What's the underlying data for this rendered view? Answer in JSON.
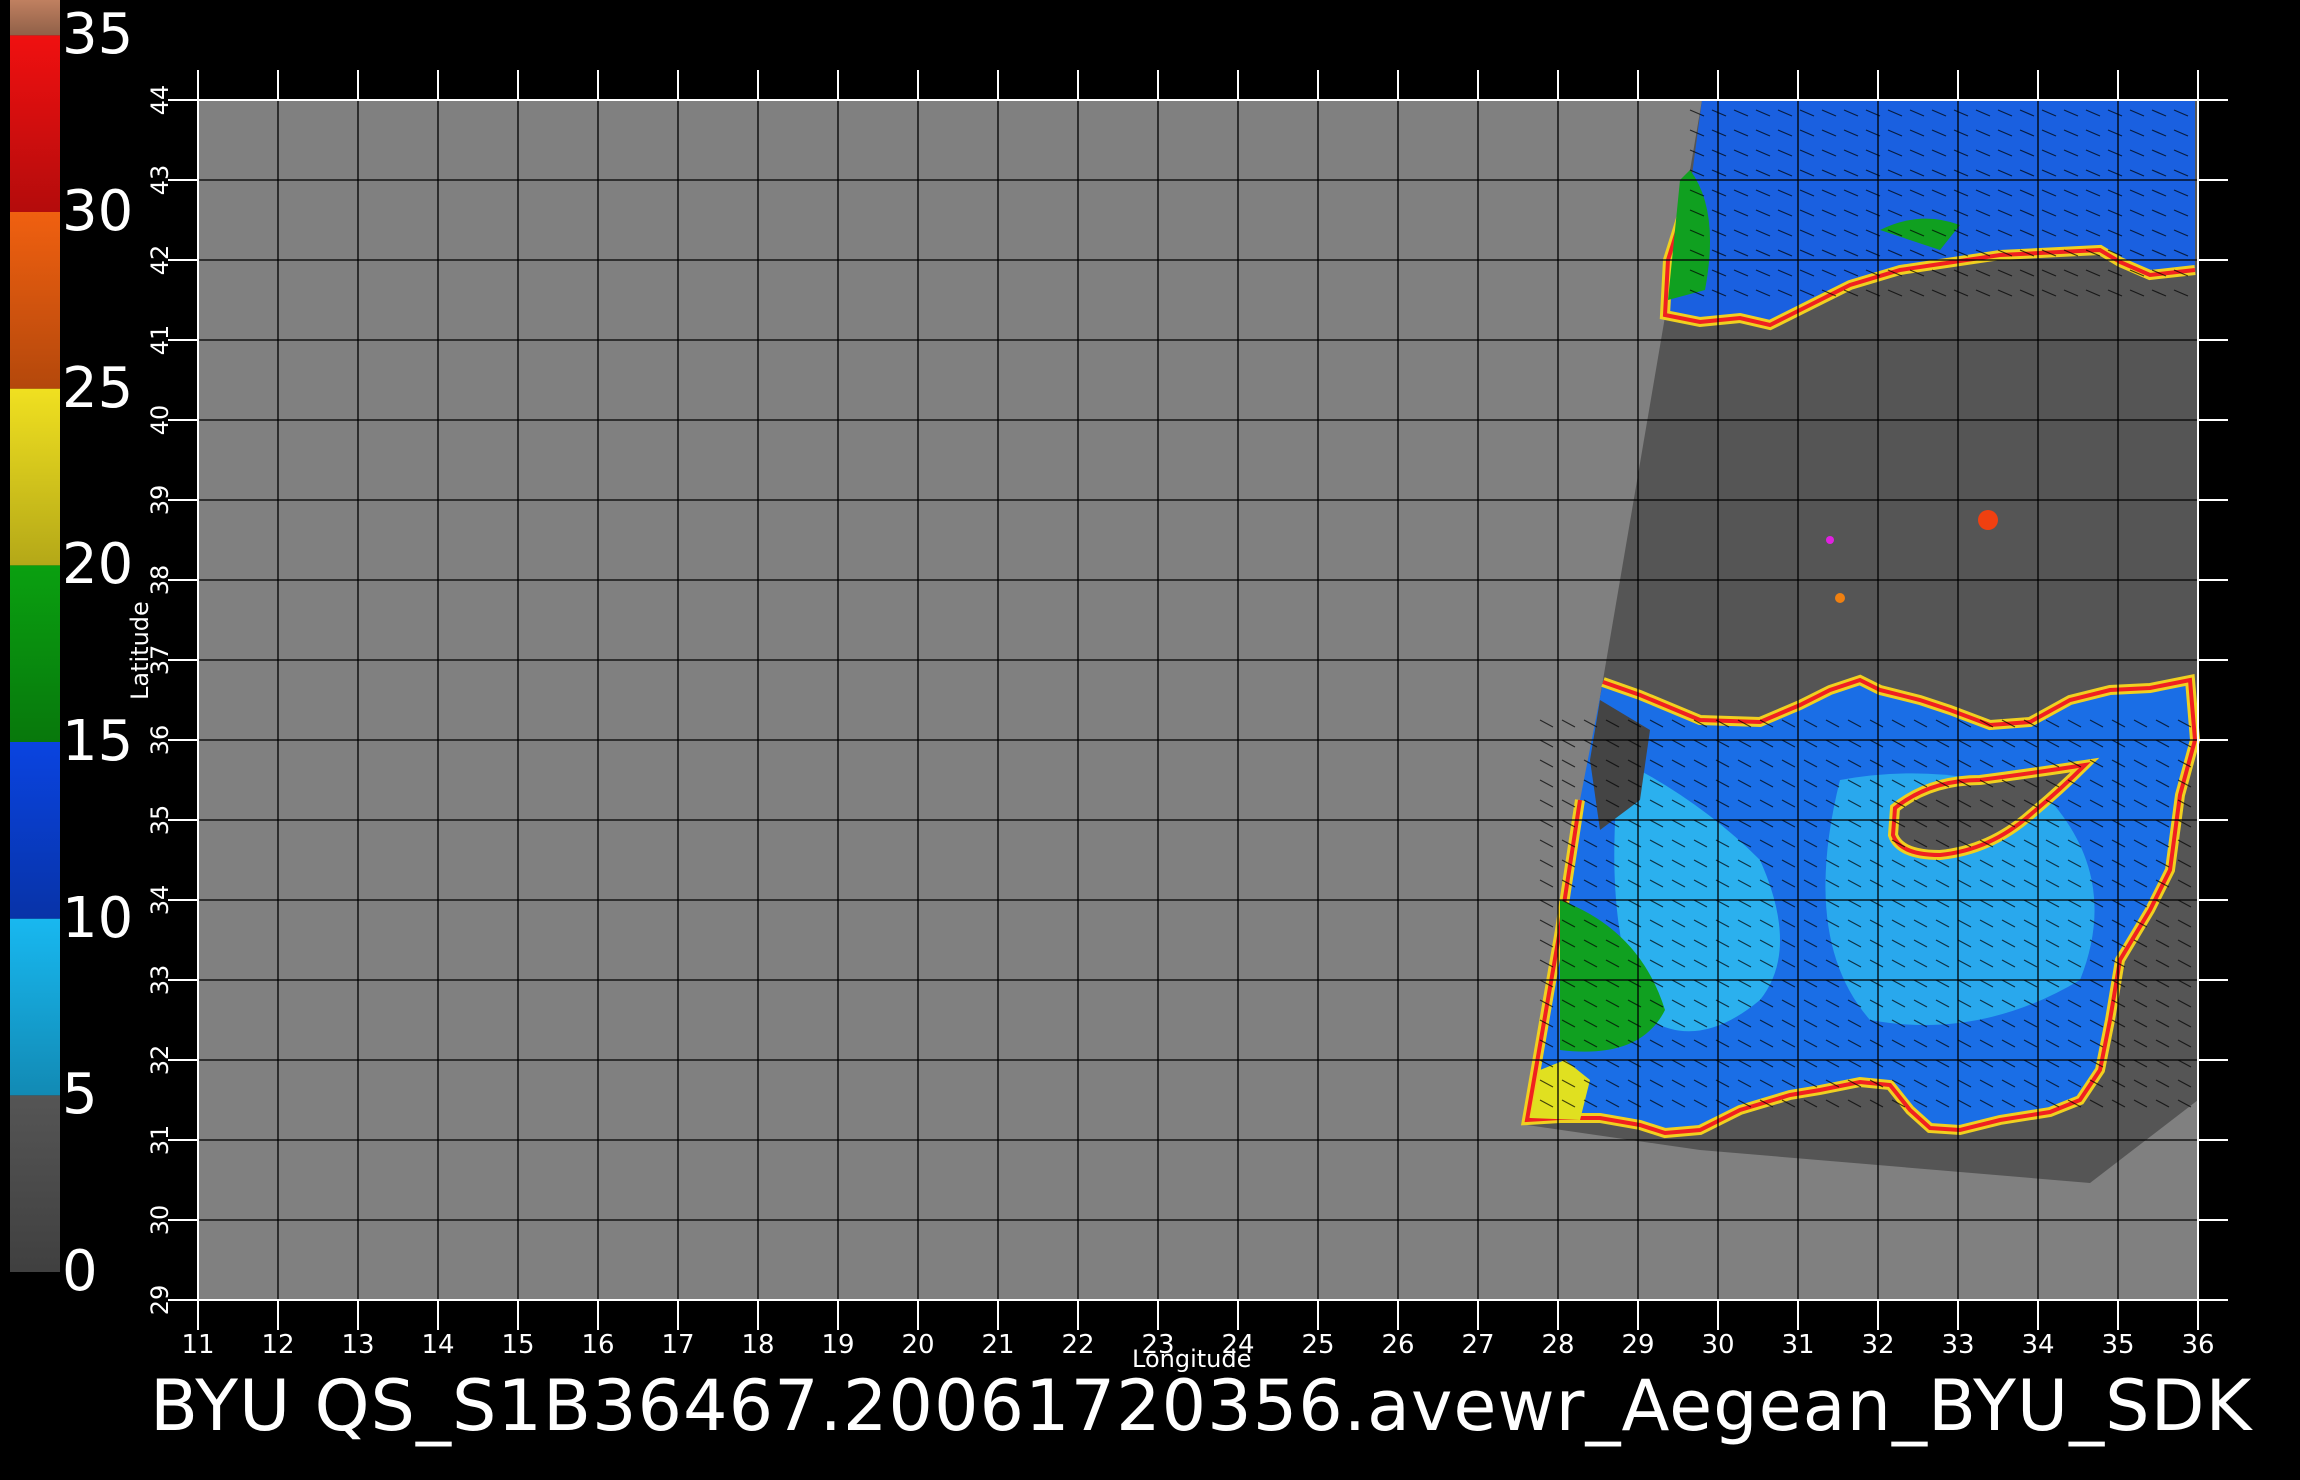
{
  "colorbar": {
    "labels": [
      "35",
      "30",
      "25",
      "20",
      "15",
      "10",
      "5",
      "0"
    ],
    "segments": [
      {
        "from": 0,
        "to": 5,
        "color": "#555555"
      },
      {
        "from": 5,
        "to": 10,
        "color": "#18b8f0"
      },
      {
        "from": 10,
        "to": 15,
        "color": "#0a44e0"
      },
      {
        "from": 15,
        "to": 20,
        "color": "#0aa010"
      },
      {
        "from": 20,
        "to": 25,
        "color": "#f0e020"
      },
      {
        "from": 25,
        "to": 30,
        "color": "#f06010"
      },
      {
        "from": 30,
        "to": 35,
        "color": "#f01010"
      },
      {
        "from": 35,
        "to": 36,
        "color": "#c08060"
      }
    ]
  },
  "map": {
    "lon_ticks": [
      "11",
      "12",
      "13",
      "14",
      "15",
      "16",
      "17",
      "18",
      "19",
      "20",
      "21",
      "22",
      "23",
      "24",
      "25",
      "26",
      "27",
      "28",
      "29",
      "30",
      "31",
      "32",
      "33",
      "34",
      "35",
      "36"
    ],
    "lat_ticks": [
      "29",
      "30",
      "31",
      "32",
      "33",
      "34",
      "35",
      "36",
      "37",
      "38",
      "39",
      "40",
      "41",
      "42",
      "43",
      "44"
    ],
    "xlabel": "Longitude",
    "ylabel": "Latitude",
    "background_color": "#808080",
    "swath_color": "#555555",
    "grid_color": "#000000"
  },
  "caption": "BYU  QS_S1B36467.20061720356.avewr_Aegean_BYU_SDK"
}
